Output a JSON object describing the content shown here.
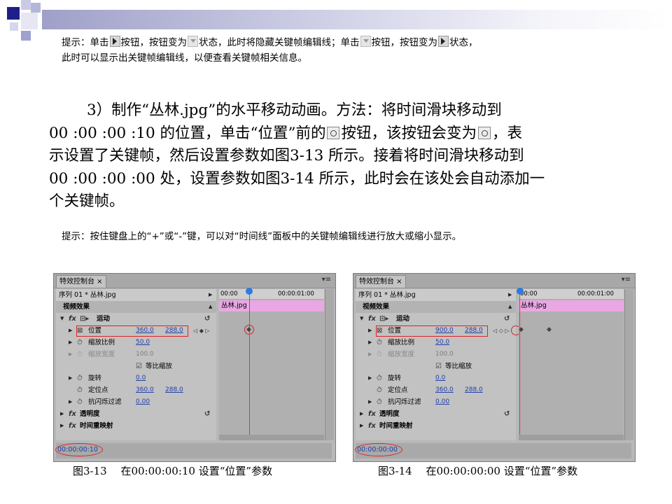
{
  "tip1": {
    "a": "提示：单击",
    "b": "按钮，按钮变为",
    "c": "状态，此时将隐藏关键帧编辑线；单击",
    "d": "按钮，按钮变为",
    "e": "状态，",
    "line2": "此时可以显示出关键帧编辑线，以便查看关键帧相关信息。"
  },
  "main": {
    "a": "3）制作“丛林.jpg”的水平移动动画。方法：将时间滑块移动到",
    "b": "00 :00 :00 :10 的位置，单击“位置”前的",
    "c": "按钮，该按钮会变为",
    "d": "，表",
    "e": "示设置了关键帧，然后设置参数如图3-13 所示。接着将时间滑块移动到",
    "f": "00 :00 :00 :00 处，设置参数如图3-14 所示，此时会在该处会自动添加一",
    "g": "个关键帧。"
  },
  "tip2": "提示：按住键盘上的“+”或“-”键，可以对“时间线”面板中的关键帧编辑线进行放大或缩小显示。",
  "panels": [
    {
      "tab": "特效控制台 ×",
      "menu": "▾≡",
      "sequence": "序列 01 * 丛林.jpg",
      "ruler_start": "00:00",
      "ruler_end": "00:00:01:00",
      "clip": "丛林.jpg",
      "section": "视频效果",
      "motion": "运动",
      "position_label": "位置",
      "position_x": "360.0",
      "position_y": "288.0",
      "scale_label": "缩放比例",
      "scale_val": "50.0",
      "scalew_label": "缩放宽度",
      "scalew_val": "100.0",
      "uniform": "等比缩放",
      "rotation_label": "旋转",
      "rotation_val": "0.0",
      "anchor_label": "定位点",
      "anchor_x": "360.0",
      "anchor_y": "288.0",
      "flicker_label": "抗闪烁过滤",
      "flicker_val": "0.00",
      "opacity": "透明度",
      "remap": "时间重映射",
      "timecode": "00:00:00:10"
    },
    {
      "tab": "特效控制台 ×",
      "menu": "▾≡",
      "sequence": "序列 01 * 丛林.jpg",
      "ruler_start": "00:00",
      "ruler_end": "00:00:01:00",
      "clip": "丛林.jpg",
      "section": "视频效果",
      "motion": "运动",
      "position_label": "位置",
      "position_x": "900.0",
      "position_y": "288.0",
      "scale_label": "缩放比例",
      "scale_val": "50.0",
      "scalew_label": "缩放宽度",
      "scalew_val": "100.0",
      "uniform": "等比缩放",
      "rotation_label": "旋转",
      "rotation_val": "0.0",
      "anchor_label": "定位点",
      "anchor_x": "360.0",
      "anchor_y": "288.0",
      "flicker_label": "抗闪烁过滤",
      "flicker_val": "0.00",
      "opacity": "透明度",
      "remap": "时间重映射",
      "timecode": "00:00:00:00"
    }
  ],
  "captions": [
    "图3-13　 在00:00:00:10  设置“位置”参数",
    "图3-14　 在00:00:00:00  设置“位置”参数"
  ]
}
